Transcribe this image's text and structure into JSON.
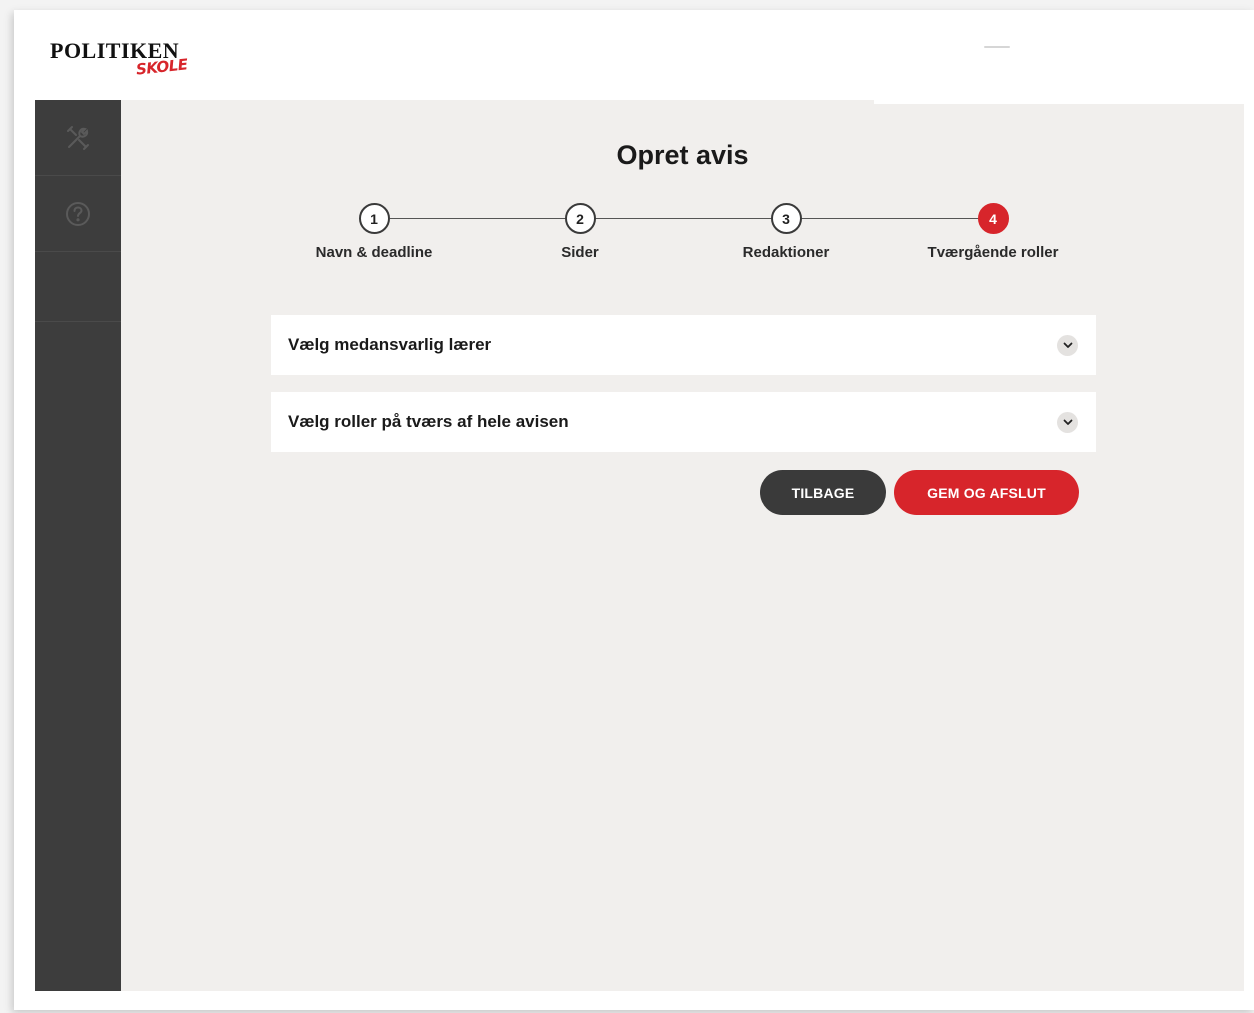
{
  "brand": {
    "name": "POLITIKEN",
    "sub": "SKOLE",
    "accent": "#d7252b"
  },
  "sidebar": {
    "items": [
      {
        "icon": "tools-icon"
      },
      {
        "icon": "help-icon"
      },
      {
        "icon": ""
      }
    ]
  },
  "page": {
    "title": "Opret avis"
  },
  "stepper": {
    "steps": [
      {
        "number": "1",
        "label": "Navn & deadline",
        "active": false
      },
      {
        "number": "2",
        "label": "Sider",
        "active": false
      },
      {
        "number": "3",
        "label": "Redaktioner",
        "active": false
      },
      {
        "number": "4",
        "label": "Tværgående roller",
        "active": true
      }
    ]
  },
  "accordions": [
    {
      "label": "Vælg medansvarlig lærer",
      "icon": "chevron-down-icon"
    },
    {
      "label": "Vælg roller på tværs af hele avisen",
      "icon": "chevron-down-icon"
    }
  ],
  "actions": {
    "back_label": "TILBAGE",
    "save_label": "GEM OG AFSLUT"
  }
}
